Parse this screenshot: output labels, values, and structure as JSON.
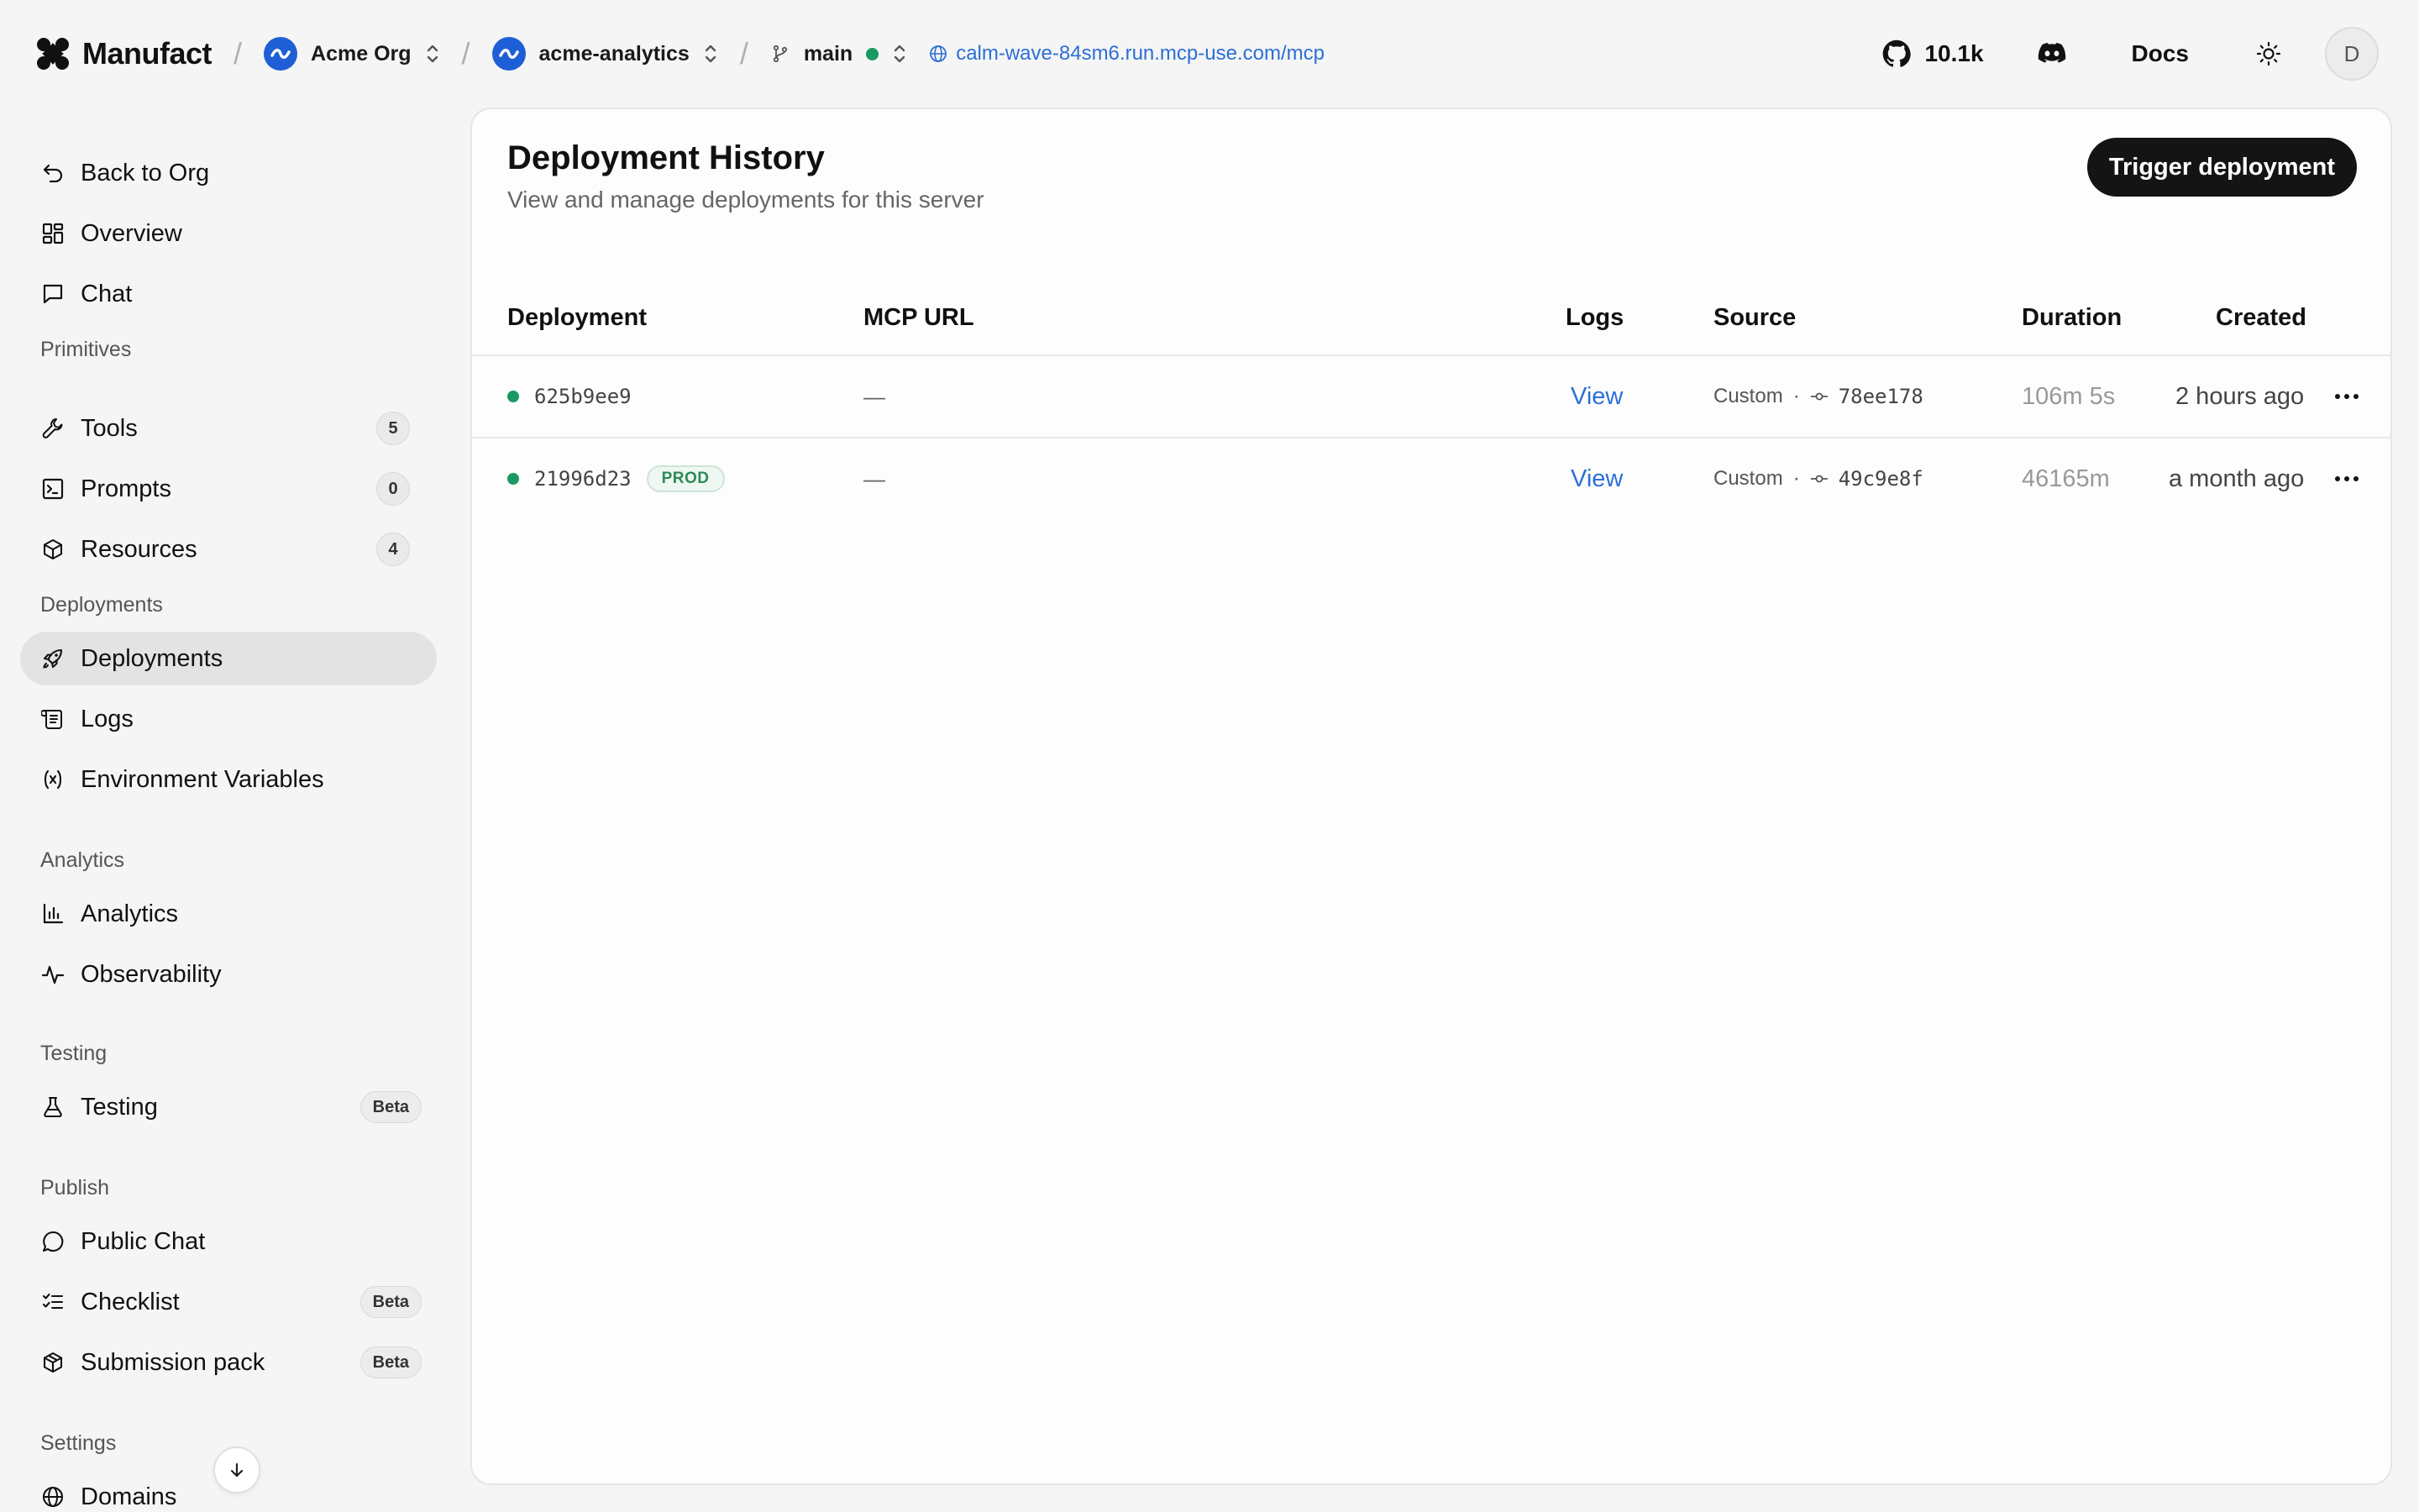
{
  "topbar": {
    "brand": "Manufact",
    "org": "Acme Org",
    "project": "acme-analytics",
    "branch": "main",
    "url": "calm-wave-84sm6.run.mcp-use.com/mcp",
    "github_stars": "10.1k",
    "docs_label": "Docs",
    "avatar_initial": "D"
  },
  "sidebar": {
    "back": "Back to Org",
    "overview": "Overview",
    "chat": "Chat",
    "primitives_title": "Primitives",
    "tools": "Tools",
    "tools_count": "5",
    "prompts": "Prompts",
    "prompts_count": "0",
    "resources": "Resources",
    "resources_count": "4",
    "deployments_title": "Deployments",
    "deployments": "Deployments",
    "logs": "Logs",
    "env_vars": "Environment Variables",
    "analytics_title": "Analytics",
    "analytics": "Analytics",
    "observability": "Observability",
    "testing_title": "Testing",
    "testing": "Testing",
    "testing_badge": "Beta",
    "publish_title": "Publish",
    "public_chat": "Public Chat",
    "checklist": "Checklist",
    "checklist_badge": "Beta",
    "submission_pack": "Submission pack",
    "submission_badge": "Beta",
    "settings_title": "Settings",
    "domains": "Domains"
  },
  "main": {
    "title": "Deployment History",
    "subtitle": "View and manage deployments for this server",
    "trigger_label": "Trigger deployment",
    "columns": {
      "deployment": "Deployment",
      "mcp_url": "MCP URL",
      "logs": "Logs",
      "source": "Source",
      "duration": "Duration",
      "created": "Created"
    },
    "rows": [
      {
        "id": "625b9ee9",
        "badge": "",
        "mcp_url": "—",
        "logs": "View",
        "source": "Custom",
        "sep": "·",
        "commit": "78ee178",
        "duration": "106m 5s",
        "created": "2 hours ago",
        "status_color": "#1a9a63"
      },
      {
        "id": "21996d23",
        "badge": "PROD",
        "mcp_url": "—",
        "logs": "View",
        "source": "Custom",
        "sep": "·",
        "commit": "49c9e8f",
        "duration": "46165m",
        "created": "a month ago",
        "status_color": "#1a9a63"
      }
    ]
  },
  "colors": {
    "accent_link": "#2b6fd6",
    "status_green": "#1a9a63",
    "button_dark": "#141414",
    "org_logo": "#1f5fd6"
  }
}
